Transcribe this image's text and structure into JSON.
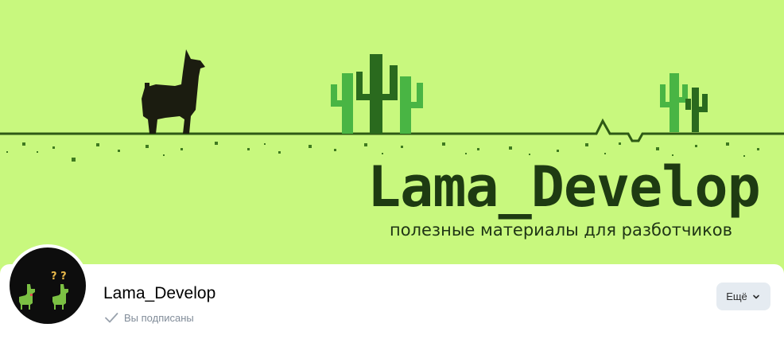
{
  "cover": {
    "title": "Lama_Develop",
    "subtitle": "полезные материалы для разботчиков",
    "background": "#c8f87e"
  },
  "group": {
    "name": "Lama_Develop",
    "subscription_status": "Вы подписаны",
    "avatar_question_marks": "? ?"
  },
  "actions": {
    "more_label": "Ещё"
  },
  "icons": {
    "check": "check-icon",
    "more_chevron": "chevron-down-icon"
  },
  "colors": {
    "accent_green": "#c8f87e",
    "text_dark_green": "#1e3b12",
    "button_bg": "#e5ebf1",
    "secondary_text": "#818c99"
  }
}
